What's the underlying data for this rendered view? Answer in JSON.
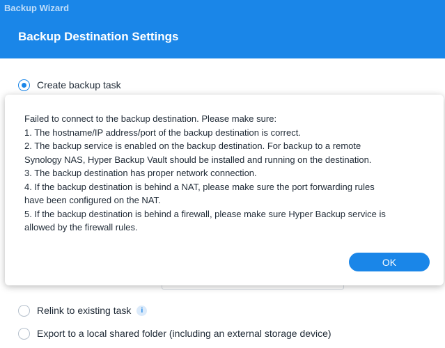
{
  "window": {
    "title": "Backup Wizard"
  },
  "header": {
    "title": "Backup Destination Settings"
  },
  "options": [
    {
      "label": "Create backup task",
      "checked": true
    },
    {
      "label": "Relink to existing task",
      "checked": false
    },
    {
      "label": "Export to a local shared folder (including an external storage device)",
      "checked": false
    }
  ],
  "dialog": {
    "message_lines": [
      "Failed to connect to the backup destination. Please make sure:",
      "1. The hostname/IP address/port of the backup destination is correct.",
      "2. The backup service is enabled on the backup destination. For backup to a remote",
      "Synology NAS, Hyper Backup Vault should be installed and running on the destination.",
      "3. The backup destination has proper network connection.",
      "4. If the backup destination is behind a NAT, please make sure the port forwarding rules",
      "have been configured on the NAT.",
      "5. If the backup destination is behind a firewall, please make sure Hyper Backup service is",
      "allowed by the firewall rules."
    ],
    "ok_label": "OK"
  },
  "colors": {
    "accent": "#1a86e8",
    "header_bg": "#1a86e8"
  }
}
